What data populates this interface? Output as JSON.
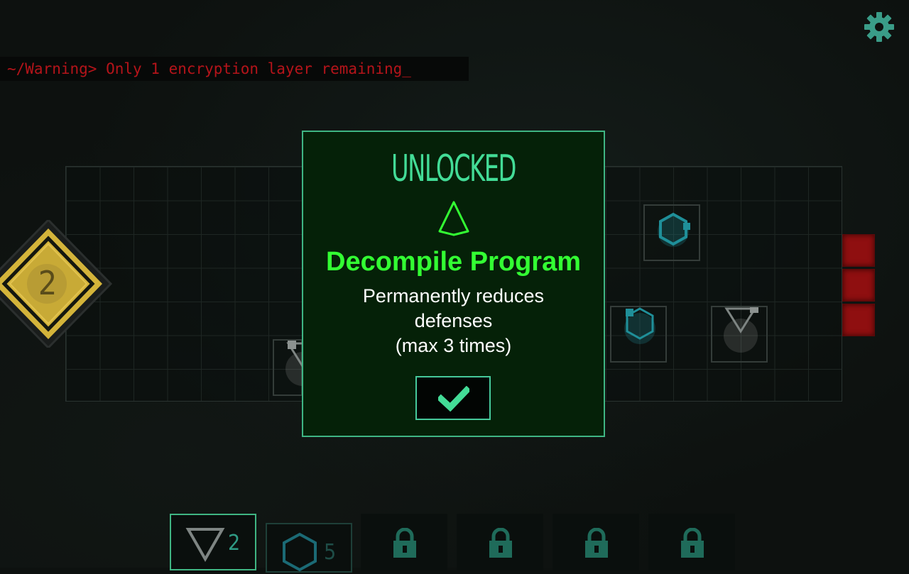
{
  "warning": {
    "text": "~/Warning> Only 1 encryption layer remaining_"
  },
  "level_badge": {
    "value": "2"
  },
  "modal": {
    "title": "UNLOCKED",
    "program_name": "Decompile Program",
    "description_lines": [
      "Permanently reduces",
      "defenses",
      "(max 3 times)"
    ]
  },
  "inventory": {
    "slots": [
      {
        "icon": "triangle-down-icon",
        "count": "2",
        "state": "selected"
      },
      {
        "icon": "hexagon-icon",
        "count": "5",
        "state": "available"
      },
      {
        "icon": "lock-icon",
        "state": "locked"
      },
      {
        "icon": "lock-icon",
        "state": "locked"
      },
      {
        "icon": "lock-icon",
        "state": "locked"
      },
      {
        "icon": "lock-icon",
        "state": "locked"
      }
    ]
  },
  "colors": {
    "accent": "#43dc97",
    "program_green": "#33ff33",
    "warning_red": "#b5141a",
    "cyan_node": "#1f8f99",
    "badge_yellow": "#d4b43a"
  }
}
